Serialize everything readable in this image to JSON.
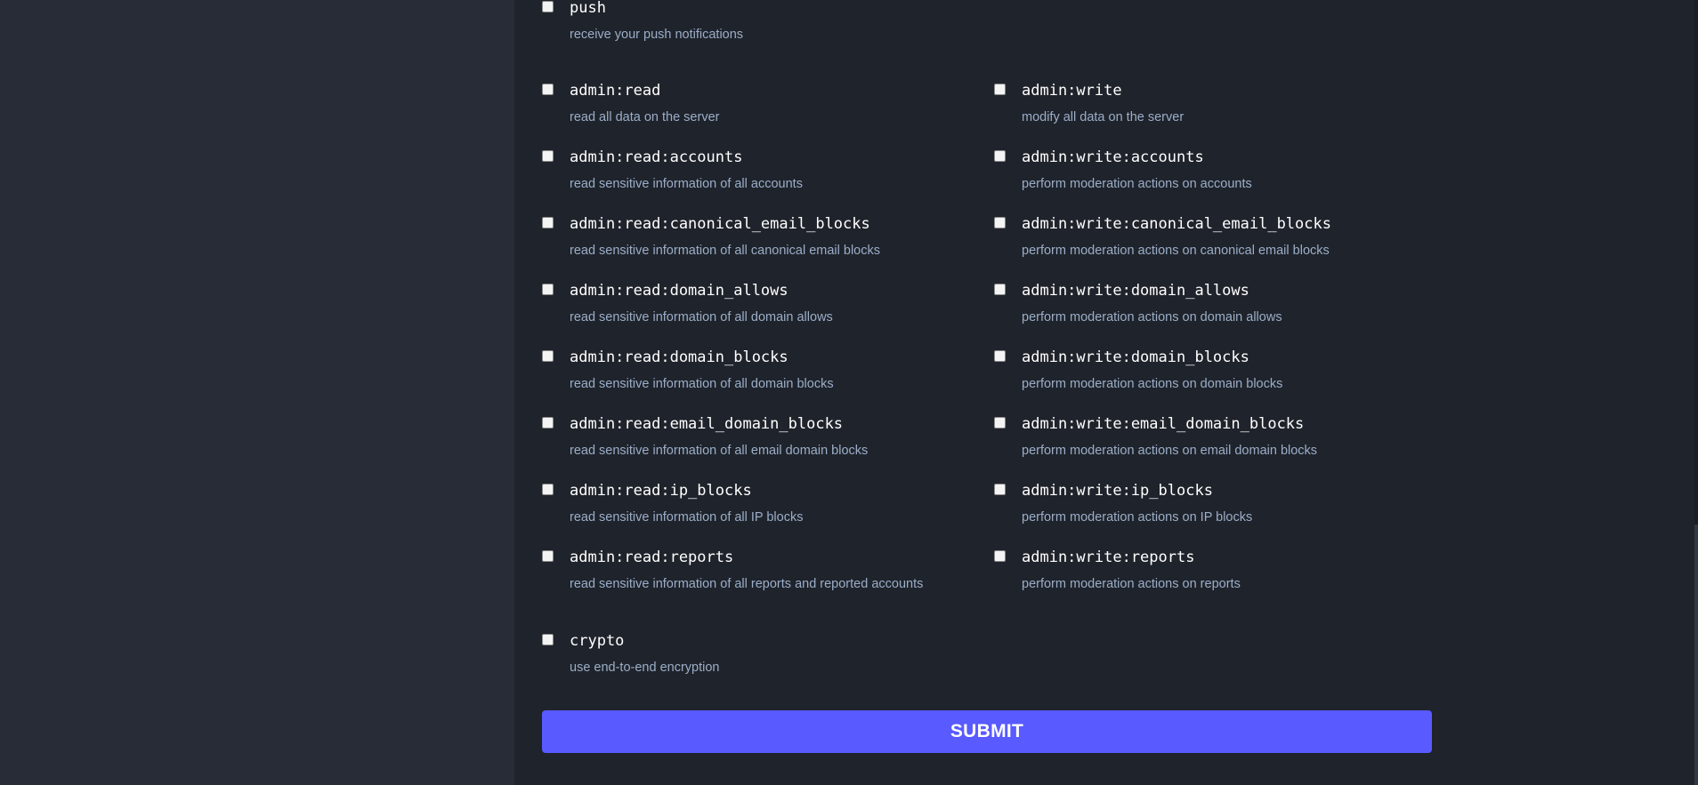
{
  "colors": {
    "page_background": "#282c37",
    "panel_background": "#1f232b",
    "title_text": "#ffffff",
    "description_text": "#9baec8",
    "submit_button": "#595aff"
  },
  "scopes": {
    "push": {
      "name": "push",
      "description": "receive your push notifications",
      "checked": false
    },
    "admin_read": [
      {
        "name": "admin:read",
        "description": "read all data on the server",
        "checked": false
      },
      {
        "name": "admin:read:accounts",
        "description": "read sensitive information of all accounts",
        "checked": false
      },
      {
        "name": "admin:read:canonical_email_blocks",
        "description": "read sensitive information of all canonical email blocks",
        "checked": false
      },
      {
        "name": "admin:read:domain_allows",
        "description": "read sensitive information of all domain allows",
        "checked": false
      },
      {
        "name": "admin:read:domain_blocks",
        "description": "read sensitive information of all domain blocks",
        "checked": false
      },
      {
        "name": "admin:read:email_domain_blocks",
        "description": "read sensitive information of all email domain blocks",
        "checked": false
      },
      {
        "name": "admin:read:ip_blocks",
        "description": "read sensitive information of all IP blocks",
        "checked": false
      },
      {
        "name": "admin:read:reports",
        "description": "read sensitive information of all reports and reported accounts",
        "checked": false
      }
    ],
    "admin_write": [
      {
        "name": "admin:write",
        "description": "modify all data on the server",
        "checked": false
      },
      {
        "name": "admin:write:accounts",
        "description": "perform moderation actions on accounts",
        "checked": false
      },
      {
        "name": "admin:write:canonical_email_blocks",
        "description": "perform moderation actions on canonical email blocks",
        "checked": false
      },
      {
        "name": "admin:write:domain_allows",
        "description": "perform moderation actions on domain allows",
        "checked": false
      },
      {
        "name": "admin:write:domain_blocks",
        "description": "perform moderation actions on domain blocks",
        "checked": false
      },
      {
        "name": "admin:write:email_domain_blocks",
        "description": "perform moderation actions on email domain blocks",
        "checked": false
      },
      {
        "name": "admin:write:ip_blocks",
        "description": "perform moderation actions on IP blocks",
        "checked": false
      },
      {
        "name": "admin:write:reports",
        "description": "perform moderation actions on reports",
        "checked": false
      }
    ],
    "crypto": {
      "name": "crypto",
      "description": "use end-to-end encryption",
      "checked": false
    }
  },
  "submit_label": "SUBMIT"
}
